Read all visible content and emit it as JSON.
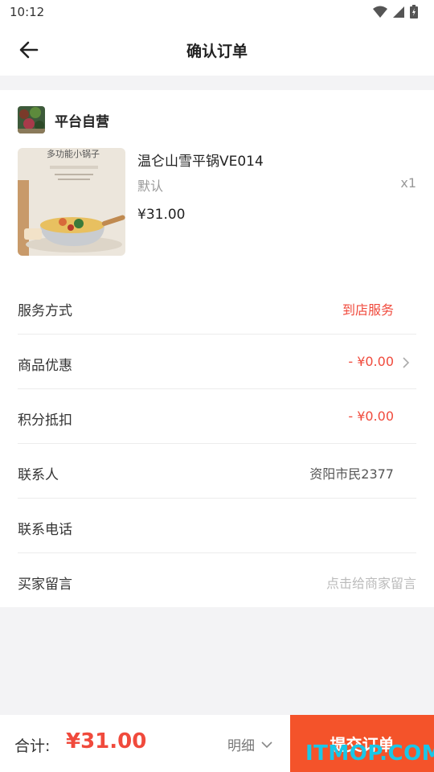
{
  "status": {
    "time": "10:12"
  },
  "header": {
    "title": "确认订单"
  },
  "shop": {
    "name": "平台自营"
  },
  "product": {
    "name": "温仑山雪平锅VE014",
    "spec": "默认",
    "qty": "x1",
    "price": "¥31.00",
    "image_text": "多功能小锅子"
  },
  "rows": [
    {
      "label": "服务方式",
      "value": "到店服务"
    },
    {
      "label": "商品优惠",
      "value": "- ¥0.00"
    },
    {
      "label": "积分抵扣",
      "value": "- ¥0.00"
    },
    {
      "label": "联系人",
      "value": "资阳市民2377"
    },
    {
      "label": "联系电话",
      "value": ""
    },
    {
      "label": "买家留言",
      "placeholder": "点击给商家留言"
    }
  ],
  "footer": {
    "total_label": "合计:",
    "total_amount": "¥31.00",
    "detail_label": "明细",
    "submit_label": "提交订单"
  },
  "watermark": "ITMOP.COM",
  "colors": {
    "accent": "#f04a3c",
    "submit_bg": "#f4532a",
    "watermark": "#19c7e8"
  }
}
